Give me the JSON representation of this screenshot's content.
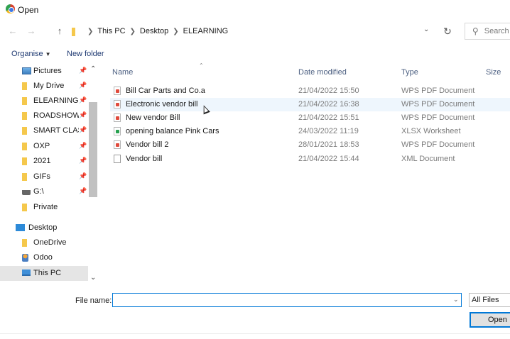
{
  "window": {
    "title": "Open"
  },
  "address": {
    "crumbs": [
      "This PC",
      "Desktop",
      "ELEARNING"
    ],
    "search_placeholder": "Search"
  },
  "toolbar": {
    "organise": "Organise",
    "new_folder": "New folder"
  },
  "nav": {
    "items": [
      {
        "label": "Pictures",
        "icon": "pictures-icon",
        "pinned": true
      },
      {
        "label": "My Drive",
        "icon": "folder-icon",
        "pinned": true
      },
      {
        "label": "ELEARNING",
        "icon": "folder-icon",
        "pinned": true
      },
      {
        "label": "ROADSHOW",
        "icon": "folder-icon",
        "pinned": true
      },
      {
        "label": "SMART CLASS",
        "icon": "folder-icon",
        "pinned": true
      },
      {
        "label": "OXP",
        "icon": "folder-icon",
        "pinned": true
      },
      {
        "label": "2021",
        "icon": "folder-icon",
        "pinned": true
      },
      {
        "label": "GIFs",
        "icon": "folder-icon",
        "pinned": true
      },
      {
        "label": "G:\\",
        "icon": "drive-icon",
        "pinned": true
      },
      {
        "label": "Private",
        "icon": "folder-icon",
        "pinned": false
      },
      {
        "label": "Desktop",
        "icon": "desktop-icon",
        "pinned": false
      },
      {
        "label": "OneDrive",
        "icon": "folder-icon",
        "pinned": false
      },
      {
        "label": "Odoo",
        "icon": "user-folder-icon",
        "pinned": false
      },
      {
        "label": "This PC",
        "icon": "pc-icon",
        "pinned": false
      }
    ]
  },
  "columns": {
    "name": "Name",
    "date": "Date modified",
    "type": "Type",
    "size": "Size"
  },
  "files": [
    {
      "name": "Bill Car Parts and Co.a",
      "date": "21/04/2022 15:50",
      "type": "WPS PDF Document",
      "kind": "pdf"
    },
    {
      "name": "Electronic vendor bill",
      "date": "21/04/2022 16:38",
      "type": "WPS PDF Document",
      "kind": "pdf"
    },
    {
      "name": "New vendor Bill",
      "date": "21/04/2022 15:51",
      "type": "WPS PDF Document",
      "kind": "pdf"
    },
    {
      "name": "opening balance Pink Cars",
      "date": "24/03/2022 11:19",
      "type": "XLSX Worksheet",
      "kind": "xlsx"
    },
    {
      "name": "Vendor bill 2",
      "date": "28/01/2021 18:53",
      "type": "WPS PDF Document",
      "kind": "pdf"
    },
    {
      "name": "Vendor bill",
      "date": "21/04/2022 15:44",
      "type": "XML Document",
      "kind": "xml"
    }
  ],
  "footer": {
    "file_name_label": "File name:",
    "file_name_value": "",
    "file_type": "All Files",
    "open_label": "Open"
  }
}
